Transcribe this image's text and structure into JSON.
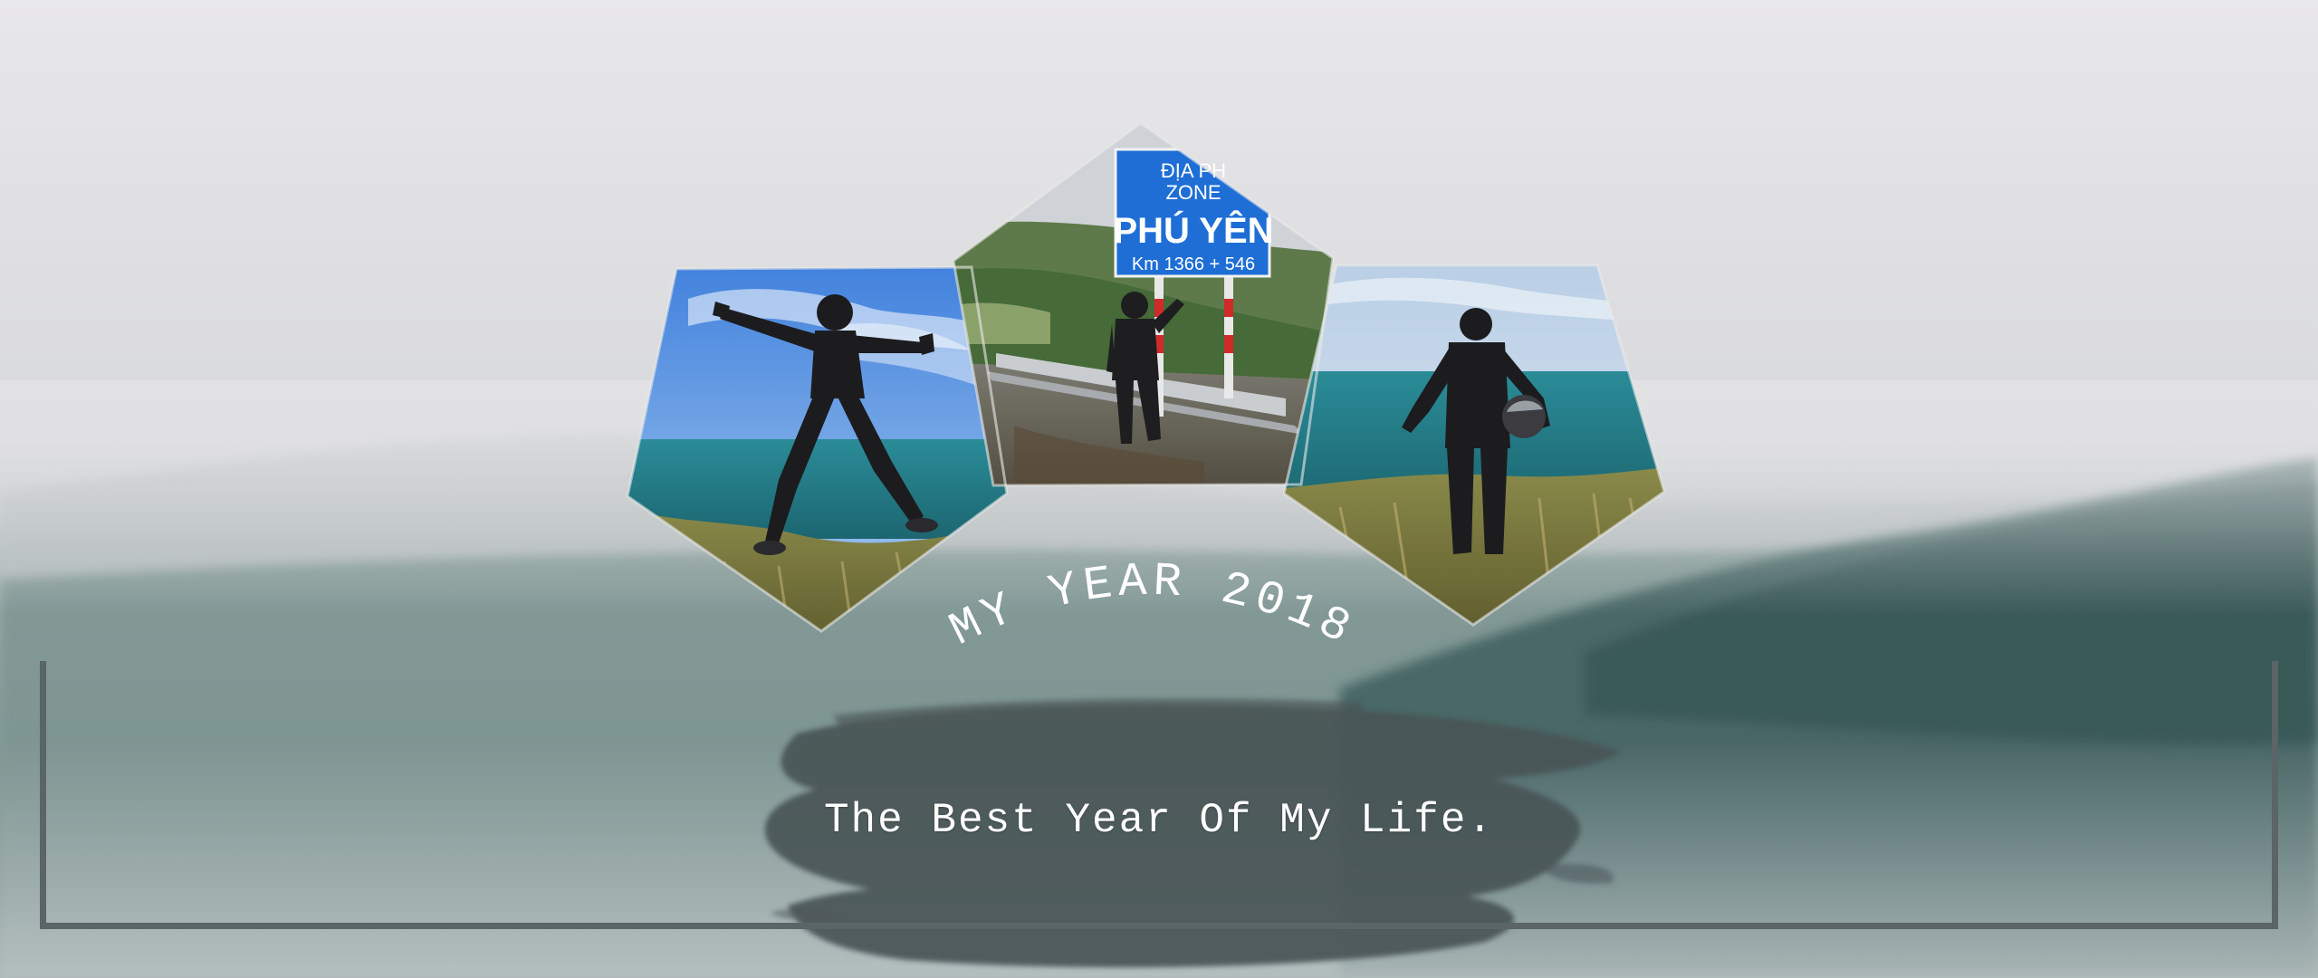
{
  "cover": {
    "arc_title": "MY YEAR 2018",
    "tagline": "The Best Year Of My Life.",
    "photos": [
      {
        "sign_top": "",
        "sign_mid": "",
        "sign_main": "",
        "sign_km": ""
      },
      {
        "sign_top": "ĐỊA PH",
        "sign_mid": "ZONE",
        "sign_main": "PHÚ YÊN",
        "sign_km": "Km 1366 + 546"
      },
      {
        "sign_top": "",
        "sign_mid": "",
        "sign_main": "",
        "sign_km": ""
      }
    ]
  },
  "colors": {
    "sky_top": "#e4e3e5",
    "fog": "#cfd2d4",
    "forest": "#4d6e6c",
    "forest_dark": "#2e4f4e",
    "brush": "#4a5456",
    "sea": "#2f8a95",
    "sign_blue": "#1e6ed6"
  }
}
